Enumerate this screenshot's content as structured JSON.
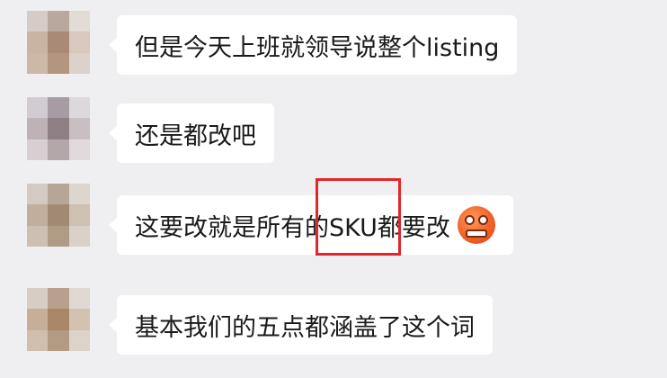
{
  "messages": [
    {
      "text": "但是今天上班就领导说整个listing",
      "has_emoji": false
    },
    {
      "text": "还是都改吧",
      "has_emoji": false
    },
    {
      "text": "这要改就是所有的SKU都要改",
      "has_emoji": true,
      "emoji": "angry-face-icon"
    },
    {
      "text": "基本我们的五点都涵盖了这个词",
      "has_emoji": false
    }
  ],
  "colors": {
    "background": "#efeff1",
    "bubble": "#ffffff",
    "highlight": "#e3262a"
  }
}
